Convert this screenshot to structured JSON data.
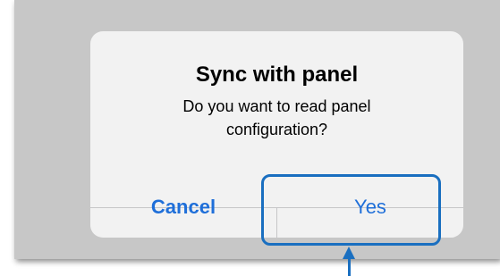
{
  "dialog": {
    "title": "Sync with panel",
    "message": "Do you want to read panel configuration?",
    "cancel_label": "Cancel",
    "yes_label": "Yes"
  },
  "colors": {
    "accent": "#1f6fd9",
    "highlight": "#1a6fc0",
    "backdrop": "#c7c7c7",
    "dialog_bg": "#f2f2f2"
  }
}
